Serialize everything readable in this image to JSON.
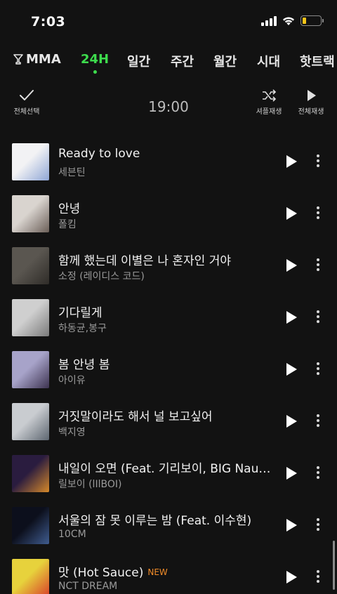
{
  "status": {
    "time": "7:03",
    "battery_level": 0.2
  },
  "tabs": [
    {
      "label": "MMA",
      "icon": "trophy-icon",
      "active": false
    },
    {
      "label": "24H",
      "active": true
    },
    {
      "label": "일간",
      "active": false
    },
    {
      "label": "주간",
      "active": false
    },
    {
      "label": "월간",
      "active": false
    },
    {
      "label": "시대",
      "active": false
    },
    {
      "label": "핫트랙",
      "active": false
    }
  ],
  "toolbar": {
    "select_all": "전체선택",
    "time": "19:00",
    "shuffle": "셔플재생",
    "play_all": "전체재생"
  },
  "songs": [
    {
      "title": "Ready to love",
      "artist": "세븐틴",
      "art_colors": [
        "#f2f2f4",
        "#8fa6d6"
      ]
    },
    {
      "title": "안녕",
      "artist": "폴킴",
      "art_colors": [
        "#d9d4cf",
        "#6b5f58"
      ]
    },
    {
      "title": "함께 했는데 이별은 나 혼자인 거야",
      "artist": "소정 (레이디스 코드)",
      "art_colors": [
        "#5a5650",
        "#2f2c28"
      ]
    },
    {
      "title": "기다릴게",
      "artist": "하동균,봉구",
      "art_colors": [
        "#cfcfcf",
        "#7a7a7a"
      ]
    },
    {
      "title": "봄 안녕 봄",
      "artist": "아이유",
      "art_colors": [
        "#a7a3c9",
        "#3d3350"
      ]
    },
    {
      "title": "거짓말이라도 해서 널 보고싶어",
      "artist": "백지영",
      "art_colors": [
        "#c9ccd0",
        "#5d6670"
      ]
    },
    {
      "title": "내일이 오면 (Feat. 기리보이, BIG Naughty)",
      "artist": "릴보이 (lIlBOI)",
      "art_colors": [
        "#2a1c3f",
        "#d6892a"
      ]
    },
    {
      "title": "서울의 잠 못 이루는 밤 (Feat. 이수현)",
      "artist": "10CM",
      "art_colors": [
        "#0c0f1c",
        "#3f5c8f"
      ]
    },
    {
      "title": "맛 (Hot Sauce)",
      "artist": "NCT DREAM",
      "badge": "NEW",
      "art_colors": [
        "#e7d23c",
        "#d8412a"
      ]
    }
  ]
}
